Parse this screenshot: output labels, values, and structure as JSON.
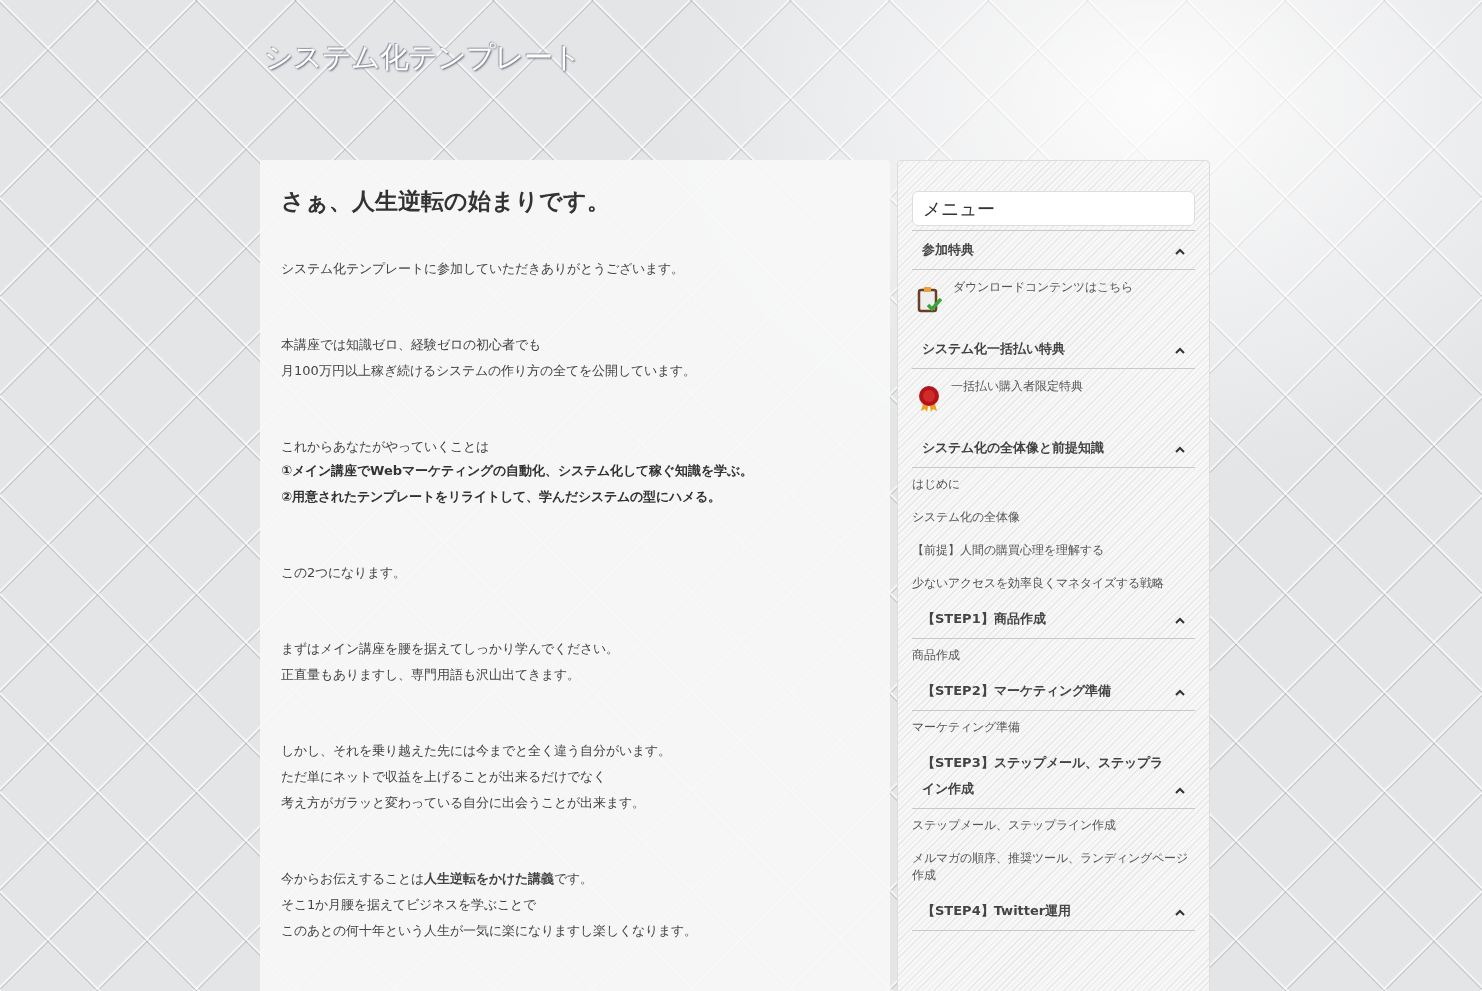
{
  "site_title": "システム化テンプレート",
  "article": {
    "title": "さぁ、人生逆転の始まりです。",
    "blocks": [
      {
        "kind": "text",
        "lines": [
          "システム化テンプレートに参加していただきありがとうございます。"
        ]
      },
      {
        "kind": "text",
        "lines": [
          "本講座では知識ゼロ、経験ゼロの初心者でも",
          "月100万円以上稼ぎ続けるシステムの作り方の全てを公開しています。"
        ]
      },
      {
        "kind": "text",
        "lines": [
          "これからあなたがやっていくことは"
        ]
      },
      {
        "kind": "emphasis",
        "lines": [
          "①メイン講座でWebマーケティングの自動化、システム化して稼ぐ知識を学ぶ。",
          "②用意されたテンプレートをリライトして、学んだシステムの型にハメる。"
        ]
      },
      {
        "kind": "text",
        "lines": [
          "この2つになります。"
        ]
      },
      {
        "kind": "text",
        "lines": [
          "まずはメイン講座を腰を据えてしっかり学んでください。",
          "正直量もありますし、専門用語も沢山出てきます。"
        ]
      },
      {
        "kind": "text",
        "lines": [
          "しかし、それを乗り越えた先には今までと全く違う自分がいます。",
          "ただ単にネットで収益を上げることが出来るだけでなく",
          "考え方がガラッと変わっている自分に出会うことが出来ます。"
        ]
      },
      {
        "kind": "text",
        "lines": [
          "今からお伝えすることは**人生逆転をかけた講義**です。",
          "そこ1か月腰を据えてビジネスを学ぶことで",
          "このあとの何十年という人生が一気に楽になりますし楽しくなります。"
        ]
      }
    ]
  },
  "sidebar": {
    "heading": "メニュー",
    "sections": [
      {
        "title": "参加特典",
        "expanded": true,
        "items": [
          {
            "text": "ダウンロードコンテンツはこちら",
            "kind": "icon"
          }
        ]
      },
      {
        "title": "システム化一括払い特典",
        "expanded": true,
        "items": [
          {
            "text": "一括払い購入者限定特典",
            "kind": "icon"
          }
        ]
      },
      {
        "title": "システム化の全体像と前提知識",
        "expanded": true,
        "items": [
          {
            "text": "はじめに"
          },
          {
            "text": "システム化の全体像"
          },
          {
            "text": "【前提】人間の購買心理を理解する"
          },
          {
            "text": "少ないアクセスを効率良くマネタイズする戦略"
          }
        ]
      },
      {
        "title": "【STEP1】商品作成",
        "expanded": true,
        "items": [
          {
            "text": "商品作成"
          }
        ]
      },
      {
        "title": "【STEP2】マーケティング準備",
        "expanded": true,
        "items": [
          {
            "text": "マーケティング準備"
          }
        ]
      },
      {
        "title": "【STEP3】ステップメール、ステップライン作成",
        "expanded": true,
        "items": [
          {
            "text": "ステップメール、ステップライン作成"
          },
          {
            "text": "メルマガの順序、推奨ツール、ランディングページ作成"
          }
        ]
      },
      {
        "title": "【STEP4】Twitter運用",
        "expanded": true
      }
    ]
  }
}
